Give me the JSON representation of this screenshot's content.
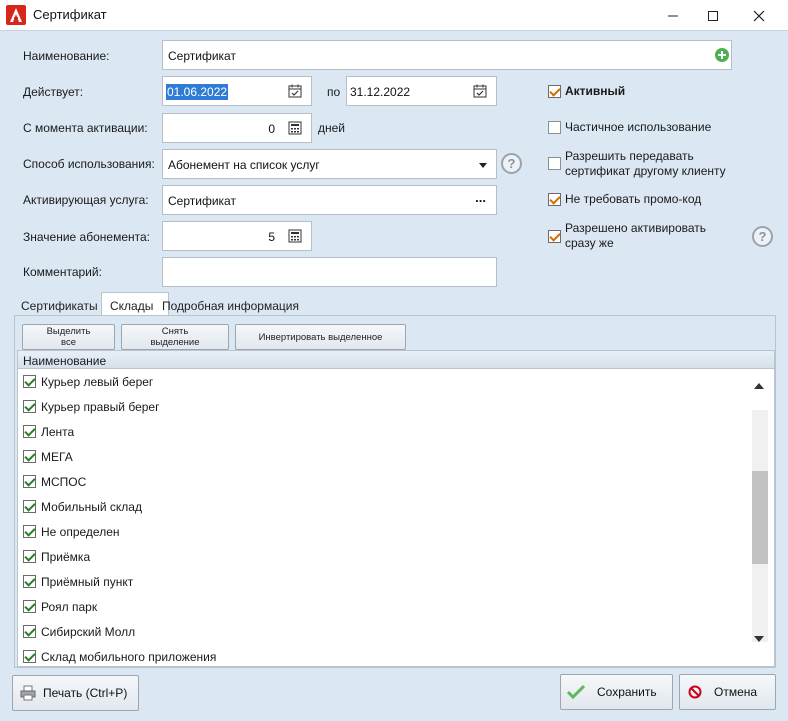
{
  "window": {
    "title": "Сертификат"
  },
  "form": {
    "name_label": "Наименование:",
    "name_value": "Сертификат",
    "valid_label": "Действует:",
    "date_from": "01.06.2022",
    "date_to_label": "по",
    "date_to": "31.12.2022",
    "activation_label": "С момента активации:",
    "activation_value": "0",
    "activation_unit": "дней",
    "usage_label": "Способ использования:",
    "usage_value": "Абонемент на список услуг",
    "service_label": "Активирующая услуга:",
    "service_value": "Сертификат",
    "service_browse": "...",
    "subscription_label": "Значение абонемента:",
    "subscription_value": "5",
    "comment_label": "Комментарий:",
    "comment_value": ""
  },
  "options": {
    "active_label": "Активный",
    "active_checked": true,
    "partial_label": "Частичное использование",
    "partial_checked": false,
    "transfer_label_1": "Разрешить передавать",
    "transfer_label_2": "сертификат другому клиенту",
    "transfer_checked": false,
    "promo_label": "Не требовать промо-код",
    "promo_checked": true,
    "immediate_label_1": "Разрешено активировать",
    "immediate_label_2": "сразу же",
    "immediate_checked": true,
    "help_symbol": "?"
  },
  "tabs": [
    {
      "label": "Сертификаты",
      "active": false
    },
    {
      "label": "Склады",
      "active": true
    },
    {
      "label": "Подробная информация",
      "active": false
    }
  ],
  "toolbar": {
    "select_all_1": "Выделить",
    "select_all_2": "все",
    "deselect_1": "Снять",
    "deselect_2": "выделение",
    "invert": "Инвертировать выделенное"
  },
  "grid": {
    "header": "Наименование",
    "rows": [
      {
        "label": "Курьер левый берег",
        "checked": true
      },
      {
        "label": "Курьер правый берег",
        "checked": true
      },
      {
        "label": "Лента",
        "checked": true
      },
      {
        "label": "МЕГА",
        "checked": true
      },
      {
        "label": "МСПОС",
        "checked": true
      },
      {
        "label": "Мобильный склад",
        "checked": true
      },
      {
        "label": "Не определен",
        "checked": true
      },
      {
        "label": "Приёмка",
        "checked": true
      },
      {
        "label": "Приёмный пункт",
        "checked": true
      },
      {
        "label": "Роял парк",
        "checked": true
      },
      {
        "label": "Сибирский Молл",
        "checked": true
      },
      {
        "label": "Склад мобильного приложения",
        "checked": true
      }
    ]
  },
  "footer": {
    "print_label": "Печать (Ctrl+P)",
    "save_label": "Сохранить",
    "cancel_label": "Отмена"
  },
  "colors": {
    "background": "#dbe7f3",
    "accent_orange": "#d76b00",
    "check_green": "#2a7d2a",
    "add_green": "#4caf50",
    "selection_blue": "#2f7bd6"
  }
}
